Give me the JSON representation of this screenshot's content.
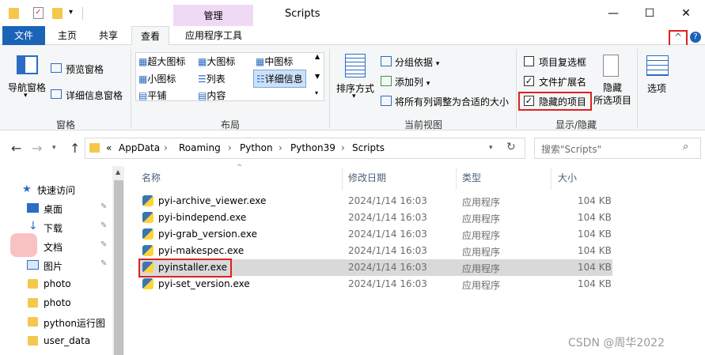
{
  "window": {
    "title": "Scripts",
    "context_tab": "管理",
    "minimize": "—",
    "maximize": "☐",
    "close": "✕"
  },
  "tabs": {
    "file": "文件",
    "home": "主页",
    "share": "共享",
    "view": "查看",
    "app_tools": "应用程序工具"
  },
  "ribbon": {
    "panes": {
      "nav_pane": "导航窗格",
      "preview_pane": "预览窗格",
      "details_pane": "详细信息窗格",
      "group_label": "窗格"
    },
    "layout": {
      "xl_icons": "超大图标",
      "large_icons": "大图标",
      "medium_icons": "中图标",
      "small_icons": "小图标",
      "list": "列表",
      "details": "详细信息",
      "tiles": "平铺",
      "content": "内容",
      "group_label": "布局"
    },
    "current_view": {
      "sort_by": "排序方式",
      "group_by": "分组依据",
      "add_columns": "添加列",
      "size_all_columns": "将所有列调整为合适的大小",
      "group_label": "当前视图"
    },
    "show_hide": {
      "item_checkboxes": "项目复选框",
      "file_extensions": "文件扩展名",
      "hidden_items": "隐藏的项目",
      "hide_selected_1": "隐藏",
      "hide_selected_2": "所选项目",
      "group_label": "显示/隐藏",
      "item_checkboxes_checked": false,
      "file_extensions_checked": true,
      "hidden_items_checked": true
    },
    "options": "选项"
  },
  "address": {
    "chevron": "«",
    "crumbs": [
      "AppData",
      "Roaming",
      "Python",
      "Python39",
      "Scripts"
    ],
    "search_placeholder": "搜索\"Scripts\""
  },
  "nav": {
    "quick_access": "快速访问",
    "items": [
      "桌面",
      "下载",
      "文档",
      "图片",
      "photo",
      "photo",
      "python运行图",
      "user_data"
    ]
  },
  "columns": {
    "name": "名称",
    "date": "修改日期",
    "type": "类型",
    "size": "大小"
  },
  "files": [
    {
      "name": "pyi-archive_viewer.exe",
      "date": "2024/1/14 16:03",
      "type": "应用程序",
      "size": "104 KB"
    },
    {
      "name": "pyi-bindepend.exe",
      "date": "2024/1/14 16:03",
      "type": "应用程序",
      "size": "104 KB"
    },
    {
      "name": "pyi-grab_version.exe",
      "date": "2024/1/14 16:03",
      "type": "应用程序",
      "size": "104 KB"
    },
    {
      "name": "pyi-makespec.exe",
      "date": "2024/1/14 16:03",
      "type": "应用程序",
      "size": "104 KB"
    },
    {
      "name": "pyinstaller.exe",
      "date": "2024/1/14 16:03",
      "type": "应用程序",
      "size": "104 KB"
    },
    {
      "name": "pyi-set_version.exe",
      "date": "2024/1/14 16:03",
      "type": "应用程序",
      "size": "104 KB"
    }
  ],
  "watermark": "CSDN @周华2022",
  "colors": {
    "accent": "#1a63b8",
    "context_tab": "#f0d9f5",
    "highlight": "#e02020",
    "selected_row": "#d9d9d9"
  }
}
